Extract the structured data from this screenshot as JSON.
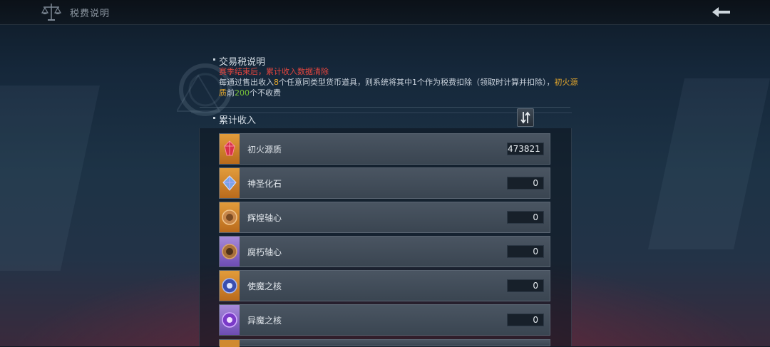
{
  "header": {
    "title": "税费说明",
    "title_icon": "scales-icon",
    "back_icon": "back-arrow-icon"
  },
  "tax_info": {
    "section_title": "交易税说明",
    "warning": "赛季结束后，累计收入数据清除",
    "desc_part1": "每通过售出收入",
    "desc_num": "8",
    "desc_part2": "个任意同类型货币道具，则系统将其中1个作为税费扣除（领取时计算并扣除），",
    "desc_item": "初火源质",
    "desc_part3": "前",
    "desc_free": "200",
    "desc_part4": "个不收费"
  },
  "income": {
    "section_title": "累计收入",
    "sort_icon": "sort-toggle-icon",
    "items": [
      {
        "name": "初火源质",
        "value": "473821",
        "icon": "red-crystal-icon",
        "frame": "orange",
        "color": "#d8304a"
      },
      {
        "name": "神圣化石",
        "value": "0",
        "icon": "blue-crystal-icon",
        "frame": "orange",
        "color": "#7aa4e8"
      },
      {
        "name": "辉煌轴心",
        "value": "0",
        "icon": "bronze-medallion-icon",
        "frame": "orange",
        "color": "#c8874a"
      },
      {
        "name": "腐朽轴心",
        "value": "0",
        "icon": "rusted-medallion-icon",
        "frame": "purple",
        "color": "#a8703a"
      },
      {
        "name": "使魔之核",
        "value": "0",
        "icon": "blue-orb-icon",
        "frame": "orange",
        "color": "#3a4fb0"
      },
      {
        "name": "异魔之核",
        "value": "0",
        "icon": "purple-orb-icon",
        "frame": "purple",
        "color": "#7a3ac8"
      }
    ]
  },
  "colors": {
    "warning": "#e2453e",
    "highlight": "#e7a92c",
    "free_count": "#79c239"
  }
}
